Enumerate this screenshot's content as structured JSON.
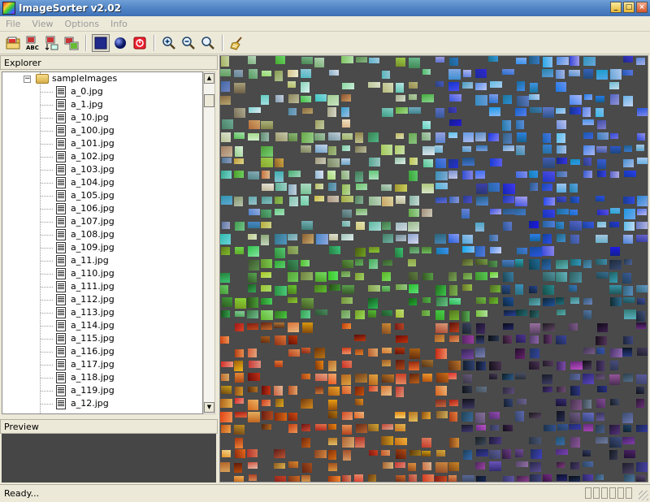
{
  "window": {
    "title": "ImageSorter v2.02"
  },
  "menu": [
    "File",
    "View",
    "Options",
    "Info"
  ],
  "toolbar": [
    {
      "name": "open-folder-button",
      "icon": "open-folder-icon"
    },
    {
      "name": "sort-alphabetical-button",
      "icon": "sort-abc-icon"
    },
    {
      "name": "sort-date-button",
      "icon": "sort-date-icon"
    },
    {
      "name": "sort-size-button",
      "icon": "sort-size-icon"
    },
    {
      "name": "square-layout-button",
      "icon": "square-icon"
    },
    {
      "name": "sphere-layout-button",
      "icon": "sphere-icon"
    },
    {
      "name": "stop-button",
      "icon": "stop-icon"
    },
    {
      "name": "zoom-in-button",
      "icon": "zoom-in-icon"
    },
    {
      "name": "zoom-out-button",
      "icon": "zoom-out-icon"
    },
    {
      "name": "zoom-fit-button",
      "icon": "zoom-fit-icon"
    },
    {
      "name": "clean-button",
      "icon": "broom-icon"
    }
  ],
  "explorer": {
    "label": "Explorer",
    "folder": "sampleImages",
    "files": [
      "a_0.jpg",
      "a_1.jpg",
      "a_10.jpg",
      "a_100.jpg",
      "a_101.jpg",
      "a_102.jpg",
      "a_103.jpg",
      "a_104.jpg",
      "a_105.jpg",
      "a_106.jpg",
      "a_107.jpg",
      "a_108.jpg",
      "a_109.jpg",
      "a_11.jpg",
      "a_110.jpg",
      "a_111.jpg",
      "a_112.jpg",
      "a_113.jpg",
      "a_114.jpg",
      "a_115.jpg",
      "a_116.jpg",
      "a_117.jpg",
      "a_118.jpg",
      "a_119.jpg",
      "a_12.jpg"
    ]
  },
  "preview": {
    "label": "Preview"
  },
  "status": {
    "text": "Ready..."
  },
  "colors": {
    "titlebar": "#4f82c5",
    "canvas_bg": "#4a4a4a",
    "chrome": "#ece9d8"
  }
}
